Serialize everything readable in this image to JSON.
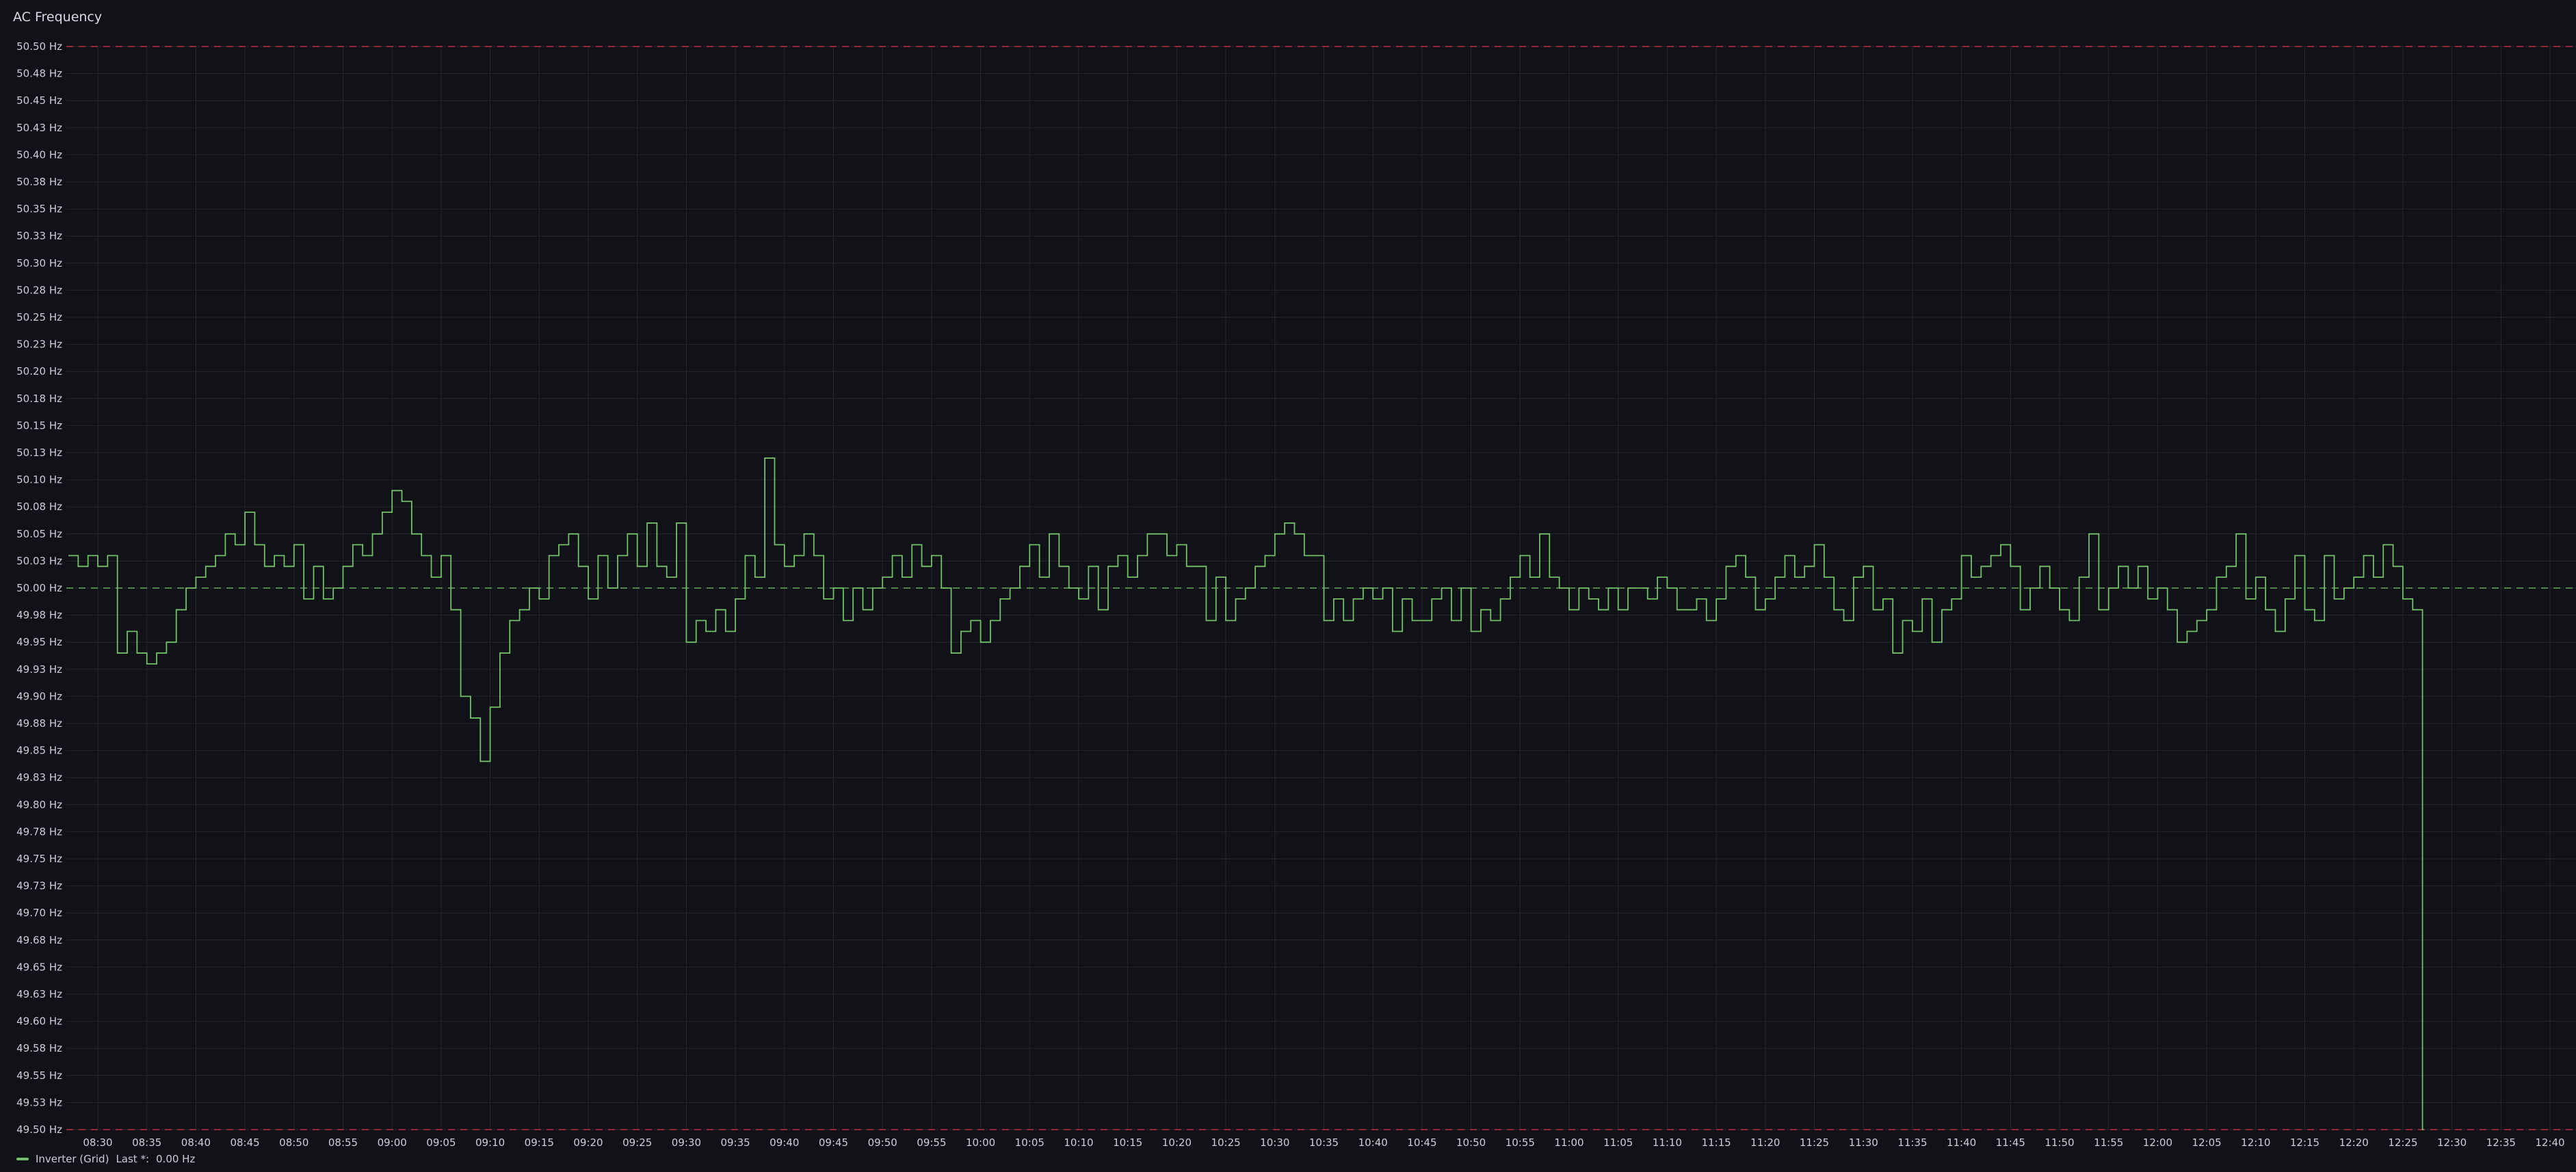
{
  "panel": {
    "title": "AC Frequency"
  },
  "legend": {
    "series_name": "Inverter (Grid)",
    "stat_label": "Last *:",
    "stat_value": "0.00 Hz"
  },
  "colors": {
    "background": "#111217",
    "grid": "#24262e",
    "series": "#73bf69",
    "threshold_high": "#e02f44",
    "threshold_nominal": "#73bf69"
  },
  "chart_data": {
    "type": "line",
    "title": "AC Frequency",
    "interpolation": "step",
    "xlabel": "",
    "ylabel": "",
    "ylim": [
      49.5,
      50.5
    ],
    "y_unit": "Hz",
    "y_ticks": [
      "50.50 Hz",
      "50.48 Hz",
      "50.45 Hz",
      "50.43 Hz",
      "50.40 Hz",
      "50.38 Hz",
      "50.35 Hz",
      "50.33 Hz",
      "50.30 Hz",
      "50.28 Hz",
      "50.25 Hz",
      "50.23 Hz",
      "50.20 Hz",
      "50.18 Hz",
      "50.15 Hz",
      "50.13 Hz",
      "50.10 Hz",
      "50.08 Hz",
      "50.05 Hz",
      "50.03 Hz",
      "50.00 Hz",
      "49.98 Hz",
      "49.95 Hz",
      "49.93 Hz",
      "49.90 Hz",
      "49.88 Hz",
      "49.85 Hz",
      "49.83 Hz",
      "49.80 Hz",
      "49.78 Hz",
      "49.75 Hz",
      "49.73 Hz",
      "49.70 Hz",
      "49.68 Hz",
      "49.65 Hz",
      "49.63 Hz",
      "49.60 Hz",
      "49.58 Hz",
      "49.55 Hz",
      "49.53 Hz",
      "49.50 Hz"
    ],
    "x_ticks": [
      "08:30",
      "08:35",
      "08:40",
      "08:45",
      "08:50",
      "08:55",
      "09:00",
      "09:05",
      "09:10",
      "09:15",
      "09:20",
      "09:25",
      "09:30",
      "09:35",
      "09:40",
      "09:45",
      "09:50",
      "09:55",
      "10:00",
      "10:05",
      "10:10",
      "10:15",
      "10:20",
      "10:25",
      "10:30",
      "10:35",
      "10:40",
      "10:45",
      "10:50",
      "10:55",
      "11:00",
      "11:05",
      "11:10",
      "11:15",
      "11:20",
      "11:25",
      "11:30",
      "11:35",
      "11:40",
      "11:45",
      "11:50",
      "11:55",
      "12:00",
      "12:05",
      "12:10",
      "12:15",
      "12:20",
      "12:25",
      "12:30",
      "12:35",
      "12:40"
    ],
    "thresholds": [
      {
        "value": 50.5,
        "style": "dashed",
        "color": "#e02f44"
      },
      {
        "value": 50.0,
        "style": "dashed",
        "color": "#73bf69"
      },
      {
        "value": 49.5,
        "style": "dashed",
        "color": "#e02f44"
      }
    ],
    "series": [
      {
        "name": "Inverter (Grid)",
        "color": "#73bf69",
        "points": [
          [
            "08:27",
            50.03
          ],
          [
            "08:28",
            50.02
          ],
          [
            "08:29",
            50.03
          ],
          [
            "08:30",
            50.02
          ],
          [
            "08:31",
            50.03
          ],
          [
            "08:32",
            49.94
          ],
          [
            "08:33",
            49.96
          ],
          [
            "08:34",
            49.94
          ],
          [
            "08:35",
            49.93
          ],
          [
            "08:36",
            49.94
          ],
          [
            "08:37",
            49.95
          ],
          [
            "08:38",
            49.98
          ],
          [
            "08:39",
            50.0
          ],
          [
            "08:40",
            50.01
          ],
          [
            "08:41",
            50.02
          ],
          [
            "08:42",
            50.03
          ],
          [
            "08:43",
            50.05
          ],
          [
            "08:44",
            50.04
          ],
          [
            "08:45",
            50.07
          ],
          [
            "08:46",
            50.04
          ],
          [
            "08:47",
            50.02
          ],
          [
            "08:48",
            50.03
          ],
          [
            "08:49",
            50.02
          ],
          [
            "08:50",
            50.04
          ],
          [
            "08:51",
            49.99
          ],
          [
            "08:52",
            50.02
          ],
          [
            "08:53",
            49.99
          ],
          [
            "08:54",
            50.0
          ],
          [
            "08:55",
            50.02
          ],
          [
            "08:56",
            50.04
          ],
          [
            "08:57",
            50.03
          ],
          [
            "08:58",
            50.05
          ],
          [
            "08:59",
            50.07
          ],
          [
            "09:00",
            50.09
          ],
          [
            "09:01",
            50.08
          ],
          [
            "09:02",
            50.05
          ],
          [
            "09:03",
            50.03
          ],
          [
            "09:04",
            50.01
          ],
          [
            "09:05",
            50.03
          ],
          [
            "09:06",
            49.98
          ],
          [
            "09:07",
            49.9
          ],
          [
            "09:08",
            49.88
          ],
          [
            "09:09",
            49.84
          ],
          [
            "09:10",
            49.89
          ],
          [
            "09:11",
            49.94
          ],
          [
            "09:12",
            49.97
          ],
          [
            "09:13",
            49.98
          ],
          [
            "09:14",
            50.0
          ],
          [
            "09:15",
            49.99
          ],
          [
            "09:16",
            50.03
          ],
          [
            "09:17",
            50.04
          ],
          [
            "09:18",
            50.05
          ],
          [
            "09:19",
            50.02
          ],
          [
            "09:20",
            49.99
          ],
          [
            "09:21",
            50.03
          ],
          [
            "09:22",
            50.0
          ],
          [
            "09:23",
            50.03
          ],
          [
            "09:24",
            50.05
          ],
          [
            "09:25",
            50.02
          ],
          [
            "09:26",
            50.06
          ],
          [
            "09:27",
            50.02
          ],
          [
            "09:28",
            50.01
          ],
          [
            "09:29",
            50.06
          ],
          [
            "09:30",
            49.95
          ],
          [
            "09:31",
            49.97
          ],
          [
            "09:32",
            49.96
          ],
          [
            "09:33",
            49.98
          ],
          [
            "09:34",
            49.96
          ],
          [
            "09:35",
            49.99
          ],
          [
            "09:36",
            50.03
          ],
          [
            "09:37",
            50.01
          ],
          [
            "09:38",
            50.12
          ],
          [
            "09:39",
            50.04
          ],
          [
            "09:40",
            50.02
          ],
          [
            "09:41",
            50.03
          ],
          [
            "09:42",
            50.05
          ],
          [
            "09:43",
            50.03
          ],
          [
            "09:44",
            49.99
          ],
          [
            "09:45",
            50.0
          ],
          [
            "09:46",
            49.97
          ],
          [
            "09:47",
            50.0
          ],
          [
            "09:48",
            49.98
          ],
          [
            "09:49",
            50.0
          ],
          [
            "09:50",
            50.01
          ],
          [
            "09:51",
            50.03
          ],
          [
            "09:52",
            50.01
          ],
          [
            "09:53",
            50.04
          ],
          [
            "09:54",
            50.02
          ],
          [
            "09:55",
            50.03
          ],
          [
            "09:56",
            50.0
          ],
          [
            "09:57",
            49.94
          ],
          [
            "09:58",
            49.96
          ],
          [
            "09:59",
            49.97
          ],
          [
            "10:00",
            49.95
          ],
          [
            "10:01",
            49.97
          ],
          [
            "10:02",
            49.99
          ],
          [
            "10:03",
            50.0
          ],
          [
            "10:04",
            50.02
          ],
          [
            "10:05",
            50.04
          ],
          [
            "10:06",
            50.01
          ],
          [
            "10:07",
            50.05
          ],
          [
            "10:08",
            50.02
          ],
          [
            "10:09",
            50.0
          ],
          [
            "10:10",
            49.99
          ],
          [
            "10:11",
            50.02
          ],
          [
            "10:12",
            49.98
          ],
          [
            "10:13",
            50.02
          ],
          [
            "10:14",
            50.03
          ],
          [
            "10:15",
            50.01
          ],
          [
            "10:16",
            50.03
          ],
          [
            "10:17",
            50.05
          ],
          [
            "10:18",
            50.05
          ],
          [
            "10:19",
            50.03
          ],
          [
            "10:20",
            50.04
          ],
          [
            "10:21",
            50.02
          ],
          [
            "10:22",
            50.02
          ],
          [
            "10:23",
            49.97
          ],
          [
            "10:24",
            50.01
          ],
          [
            "10:25",
            49.97
          ],
          [
            "10:26",
            49.99
          ],
          [
            "10:27",
            50.0
          ],
          [
            "10:28",
            50.02
          ],
          [
            "10:29",
            50.03
          ],
          [
            "10:30",
            50.05
          ],
          [
            "10:31",
            50.06
          ],
          [
            "10:32",
            50.05
          ],
          [
            "10:33",
            50.03
          ],
          [
            "10:34",
            50.03
          ],
          [
            "10:35",
            49.97
          ],
          [
            "10:36",
            49.99
          ],
          [
            "10:37",
            49.97
          ],
          [
            "10:38",
            49.99
          ],
          [
            "10:39",
            50.0
          ],
          [
            "10:40",
            49.99
          ],
          [
            "10:41",
            50.0
          ],
          [
            "10:42",
            49.96
          ],
          [
            "10:43",
            49.99
          ],
          [
            "10:44",
            49.97
          ],
          [
            "10:45",
            49.97
          ],
          [
            "10:46",
            49.99
          ],
          [
            "10:47",
            50.0
          ],
          [
            "10:48",
            49.97
          ],
          [
            "10:49",
            50.0
          ],
          [
            "10:50",
            49.96
          ],
          [
            "10:51",
            49.98
          ],
          [
            "10:52",
            49.97
          ],
          [
            "10:53",
            49.99
          ],
          [
            "10:54",
            50.01
          ],
          [
            "10:55",
            50.03
          ],
          [
            "10:56",
            50.01
          ],
          [
            "10:57",
            50.05
          ],
          [
            "10:58",
            50.01
          ],
          [
            "10:59",
            50.0
          ],
          [
            "11:00",
            49.98
          ],
          [
            "11:01",
            50.0
          ],
          [
            "11:02",
            49.99
          ],
          [
            "11:03",
            49.98
          ],
          [
            "11:04",
            50.0
          ],
          [
            "11:05",
            49.98
          ],
          [
            "11:06",
            50.0
          ],
          [
            "11:07",
            50.0
          ],
          [
            "11:08",
            49.99
          ],
          [
            "11:09",
            50.01
          ],
          [
            "11:10",
            50.0
          ],
          [
            "11:11",
            49.98
          ],
          [
            "11:12",
            49.98
          ],
          [
            "11:13",
            49.99
          ],
          [
            "11:14",
            49.97
          ],
          [
            "11:15",
            49.99
          ],
          [
            "11:16",
            50.02
          ],
          [
            "11:17",
            50.03
          ],
          [
            "11:18",
            50.01
          ],
          [
            "11:19",
            49.98
          ],
          [
            "11:20",
            49.99
          ],
          [
            "11:21",
            50.01
          ],
          [
            "11:22",
            50.03
          ],
          [
            "11:23",
            50.01
          ],
          [
            "11:24",
            50.02
          ],
          [
            "11:25",
            50.04
          ],
          [
            "11:26",
            50.01
          ],
          [
            "11:27",
            49.98
          ],
          [
            "11:28",
            49.97
          ],
          [
            "11:29",
            50.01
          ],
          [
            "11:30",
            50.02
          ],
          [
            "11:31",
            49.98
          ],
          [
            "11:32",
            49.99
          ],
          [
            "11:33",
            49.94
          ],
          [
            "11:34",
            49.97
          ],
          [
            "11:35",
            49.96
          ],
          [
            "11:36",
            49.99
          ],
          [
            "11:37",
            49.95
          ],
          [
            "11:38",
            49.98
          ],
          [
            "11:39",
            49.99
          ],
          [
            "11:40",
            50.03
          ],
          [
            "11:41",
            50.01
          ],
          [
            "11:42",
            50.02
          ],
          [
            "11:43",
            50.03
          ],
          [
            "11:44",
            50.04
          ],
          [
            "11:45",
            50.02
          ],
          [
            "11:46",
            49.98
          ],
          [
            "11:47",
            50.0
          ],
          [
            "11:48",
            50.02
          ],
          [
            "11:49",
            50.0
          ],
          [
            "11:50",
            49.98
          ],
          [
            "11:51",
            49.97
          ],
          [
            "11:52",
            50.01
          ],
          [
            "11:53",
            50.05
          ],
          [
            "11:54",
            49.98
          ],
          [
            "11:55",
            50.0
          ],
          [
            "11:56",
            50.02
          ],
          [
            "11:57",
            50.0
          ],
          [
            "11:58",
            50.02
          ],
          [
            "11:59",
            49.99
          ],
          [
            "12:00",
            50.0
          ],
          [
            "12:01",
            49.98
          ],
          [
            "12:02",
            49.95
          ],
          [
            "12:03",
            49.96
          ],
          [
            "12:04",
            49.97
          ],
          [
            "12:05",
            49.98
          ],
          [
            "12:06",
            50.01
          ],
          [
            "12:07",
            50.02
          ],
          [
            "12:08",
            50.05
          ],
          [
            "12:09",
            49.99
          ],
          [
            "12:10",
            50.01
          ],
          [
            "12:11",
            49.98
          ],
          [
            "12:12",
            49.96
          ],
          [
            "12:13",
            49.99
          ],
          [
            "12:14",
            50.03
          ],
          [
            "12:15",
            49.98
          ],
          [
            "12:16",
            49.97
          ],
          [
            "12:17",
            50.03
          ],
          [
            "12:18",
            49.99
          ],
          [
            "12:19",
            50.0
          ],
          [
            "12:20",
            50.01
          ],
          [
            "12:21",
            50.03
          ],
          [
            "12:22",
            50.01
          ],
          [
            "12:23",
            50.04
          ],
          [
            "12:24",
            50.02
          ],
          [
            "12:25",
            49.99
          ],
          [
            "12:26",
            49.98
          ],
          [
            "12:27",
            0.0
          ]
        ]
      }
    ]
  }
}
